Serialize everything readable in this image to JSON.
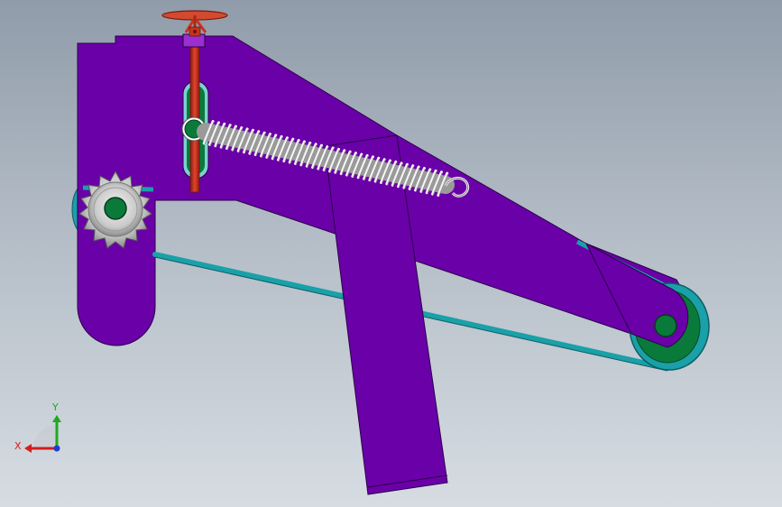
{
  "viewport": {
    "background_top": "#909caa",
    "background_bottom": "#d6dce2"
  },
  "model": {
    "frame_color": "#6a00a8",
    "belt_color": "#1aa0a8",
    "pulley_color": "#0a7a3a",
    "rod_color": "#c8321e",
    "spring_color": "#f0f0f0",
    "sprocket_color": "#c8c8c8"
  },
  "triad": {
    "x_label": "X",
    "y_label": "Y",
    "x_color": "#d21e1e",
    "y_color": "#1eaa1e",
    "z_color": "#1e3cd2",
    "icons": [
      "axis-x-icon",
      "axis-y-icon",
      "axis-z-icon"
    ]
  }
}
